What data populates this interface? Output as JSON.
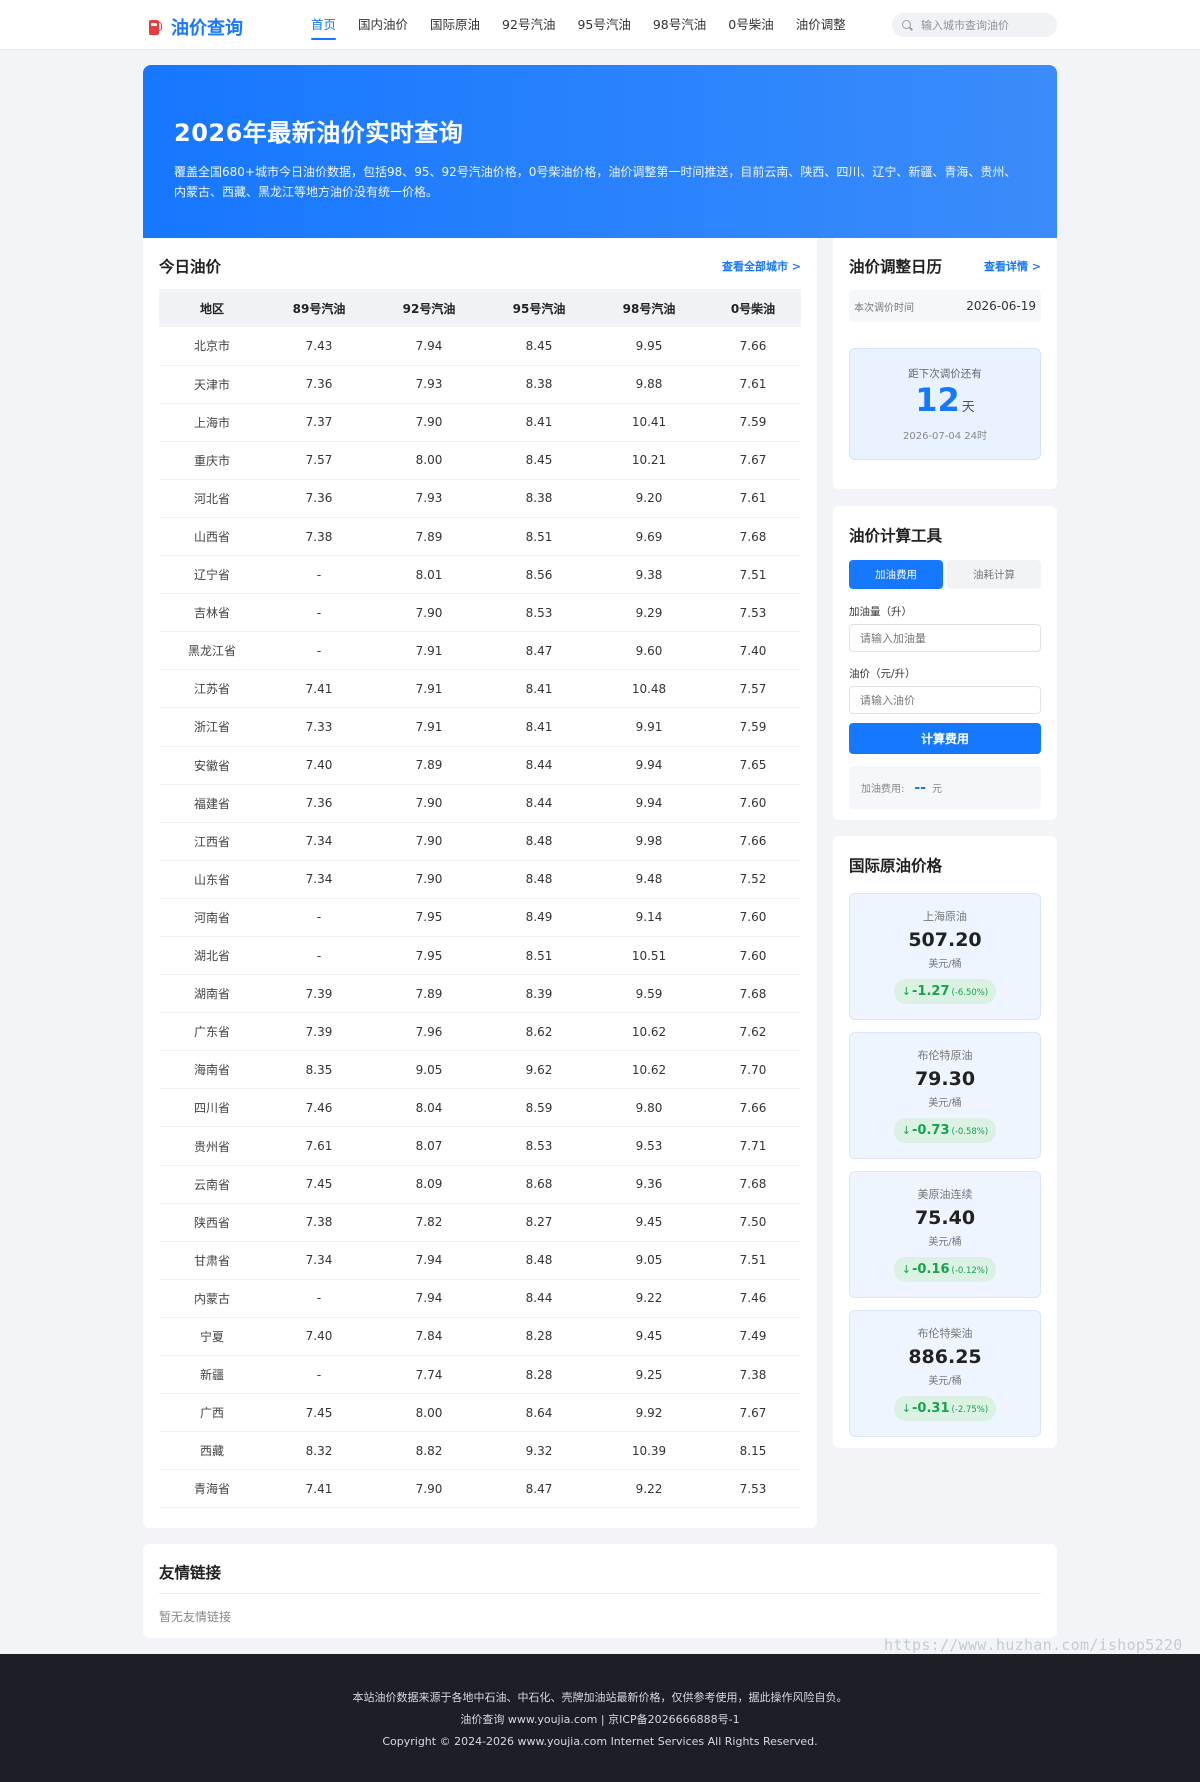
{
  "header": {
    "logo_text": "油价查询",
    "nav": [
      {
        "label": "首页",
        "active": true
      },
      {
        "label": "国内油价",
        "active": false
      },
      {
        "label": "国际原油",
        "active": false
      },
      {
        "label": "92号汽油",
        "active": false
      },
      {
        "label": "95号汽油",
        "active": false
      },
      {
        "label": "98号汽油",
        "active": false
      },
      {
        "label": "0号柴油",
        "active": false
      },
      {
        "label": "油价调整",
        "active": false
      }
    ],
    "search_placeholder": "输入城市查询油价"
  },
  "hero": {
    "title": "2026年最新油价实时查询",
    "description": "覆盖全国680+城市今日油价数据，包括98、95、92号汽油价格，0号柴油价格，油价调整第一时间推送，目前云南、陕西、四川、辽宁、新疆、青海、贵州、内蒙古、西藏、黑龙江等地方油价没有统一价格。"
  },
  "price_table": {
    "title": "今日油价",
    "link": "查看全部城市 >",
    "columns": [
      "地区",
      "89号汽油",
      "92号汽油",
      "95号汽油",
      "98号汽油",
      "0号柴油"
    ],
    "rows": [
      [
        "北京市",
        "7.43",
        "7.94",
        "8.45",
        "9.95",
        "7.66"
      ],
      [
        "天津市",
        "7.36",
        "7.93",
        "8.38",
        "9.88",
        "7.61"
      ],
      [
        "上海市",
        "7.37",
        "7.90",
        "8.41",
        "10.41",
        "7.59"
      ],
      [
        "重庆市",
        "7.57",
        "8.00",
        "8.45",
        "10.21",
        "7.67"
      ],
      [
        "河北省",
        "7.36",
        "7.93",
        "8.38",
        "9.20",
        "7.61"
      ],
      [
        "山西省",
        "7.38",
        "7.89",
        "8.51",
        "9.69",
        "7.68"
      ],
      [
        "辽宁省",
        "-",
        "8.01",
        "8.56",
        "9.38",
        "7.51"
      ],
      [
        "吉林省",
        "-",
        "7.90",
        "8.53",
        "9.29",
        "7.53"
      ],
      [
        "黑龙江省",
        "-",
        "7.91",
        "8.47",
        "9.60",
        "7.40"
      ],
      [
        "江苏省",
        "7.41",
        "7.91",
        "8.41",
        "10.48",
        "7.57"
      ],
      [
        "浙江省",
        "7.33",
        "7.91",
        "8.41",
        "9.91",
        "7.59"
      ],
      [
        "安徽省",
        "7.40",
        "7.89",
        "8.44",
        "9.94",
        "7.65"
      ],
      [
        "福建省",
        "7.36",
        "7.90",
        "8.44",
        "9.94",
        "7.60"
      ],
      [
        "江西省",
        "7.34",
        "7.90",
        "8.48",
        "9.98",
        "7.66"
      ],
      [
        "山东省",
        "7.34",
        "7.90",
        "8.48",
        "9.48",
        "7.52"
      ],
      [
        "河南省",
        "-",
        "7.95",
        "8.49",
        "9.14",
        "7.60"
      ],
      [
        "湖北省",
        "-",
        "7.95",
        "8.51",
        "10.51",
        "7.60"
      ],
      [
        "湖南省",
        "7.39",
        "7.89",
        "8.39",
        "9.59",
        "7.68"
      ],
      [
        "广东省",
        "7.39",
        "7.96",
        "8.62",
        "10.62",
        "7.62"
      ],
      [
        "海南省",
        "8.35",
        "9.05",
        "9.62",
        "10.62",
        "7.70"
      ],
      [
        "四川省",
        "7.46",
        "8.04",
        "8.59",
        "9.80",
        "7.66"
      ],
      [
        "贵州省",
        "7.61",
        "8.07",
        "8.53",
        "9.53",
        "7.71"
      ],
      [
        "云南省",
        "7.45",
        "8.09",
        "8.68",
        "9.36",
        "7.68"
      ],
      [
        "陕西省",
        "7.38",
        "7.82",
        "8.27",
        "9.45",
        "7.50"
      ],
      [
        "甘肃省",
        "7.34",
        "7.94",
        "8.48",
        "9.05",
        "7.51"
      ],
      [
        "内蒙古",
        "-",
        "7.94",
        "8.44",
        "9.22",
        "7.46"
      ],
      [
        "宁夏",
        "7.40",
        "7.84",
        "8.28",
        "9.45",
        "7.49"
      ],
      [
        "新疆",
        "-",
        "7.74",
        "8.28",
        "9.25",
        "7.38"
      ],
      [
        "广西",
        "7.45",
        "8.00",
        "8.64",
        "9.92",
        "7.67"
      ],
      [
        "西藏",
        "8.32",
        "8.82",
        "9.32",
        "10.39",
        "8.15"
      ],
      [
        "青海省",
        "7.41",
        "7.90",
        "8.47",
        "9.22",
        "7.53"
      ]
    ]
  },
  "calendar": {
    "title": "油价调整日历",
    "link": "查看详情 >",
    "last_label": "本次调价时间",
    "last_date": "2026-06-19",
    "countdown_label": "距下次调价还有",
    "days": "12",
    "days_unit": "天",
    "next_time": "2026-07-04 24时"
  },
  "calculator": {
    "title": "油价计算工具",
    "tabs": [
      {
        "label": "加油费用",
        "active": true
      },
      {
        "label": "油耗计算",
        "active": false
      }
    ],
    "amount_label": "加油量（升）",
    "amount_placeholder": "请输入加油量",
    "price_label": "油价（元/升）",
    "price_placeholder": "请输入油价",
    "button": "计算费用",
    "result_label": "加油费用:",
    "result_value": "--",
    "result_unit": "元"
  },
  "crude": {
    "title": "国际原油价格",
    "items": [
      {
        "name": "上海原油",
        "price": "507.20",
        "unit": "美元/桶",
        "arrow": "↓",
        "delta": "-1.27",
        "pct": "(-6.50%)"
      },
      {
        "name": "布伦特原油",
        "price": "79.30",
        "unit": "美元/桶",
        "arrow": "↓",
        "delta": "-0.73",
        "pct": "(-0.58%)"
      },
      {
        "name": "美原油连续",
        "price": "75.40",
        "unit": "美元/桶",
        "arrow": "↓",
        "delta": "-0.16",
        "pct": "(-0.12%)"
      },
      {
        "name": "布伦特柴油",
        "price": "886.25",
        "unit": "美元/桶",
        "arrow": "↓",
        "delta": "-0.31",
        "pct": "(-2.75%)"
      }
    ],
    "change_color": "#16a34a"
  },
  "links": {
    "title": "友情链接",
    "empty": "暂无友情链接"
  },
  "watermark": "https://www.huzhan.com/ishop5220",
  "footer": {
    "line1": "本站油价数据来源于各地中石油、中石化、壳牌加油站最新价格，仅供参考使用，据此操作风险自负。",
    "line2": "油价查询 www.youjia.com | 京ICP备2026666888号-1",
    "line3": "Copyright © 2024-2026 www.youjia.com Internet Services All Rights Reserved."
  },
  "colors": {
    "brand": "#1677ff",
    "footer_bg": "#1d1f27",
    "page_bg": "#f3f4f7"
  }
}
